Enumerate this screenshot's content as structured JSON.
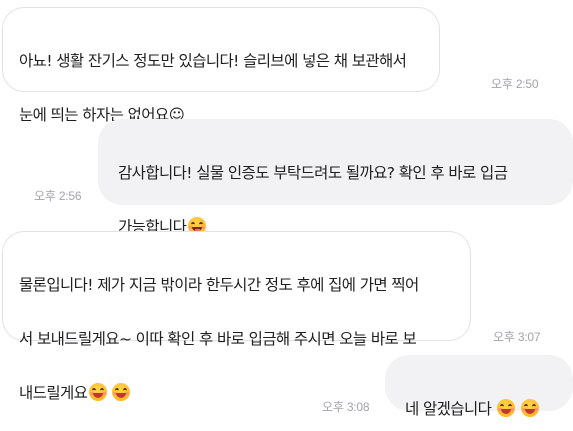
{
  "messages": [
    {
      "direction": "received",
      "lines": [
        "아뇨! 생활 잔기스 정도만 있습니다! 슬리브에 넣은 채 보관해서",
        "눈에 띄는 하자는 없어요☺"
      ],
      "time": "오후 2:50"
    },
    {
      "direction": "sent",
      "lines": [
        "감사합니다! 실물 인증도 부탁드려도 될까요? 확인 후 바로 입금",
        "가능합니다"
      ],
      "emoji": [
        "face-savoring-food"
      ],
      "time": "오후 2:56"
    },
    {
      "direction": "received",
      "lines": [
        "물론입니다! 제가 지금 밖이라 한두시간 정도 후에 집에 가면 찍어",
        "서 보내드릴게요~ 이따 확인 후 바로 입금해 주시면 오늘 바로 보",
        "내드릴게요"
      ],
      "emoji": [
        "smiling-face-with-smiling-eyes",
        "smiling-face-with-smiling-eyes"
      ],
      "time": "오후 3:07"
    },
    {
      "direction": "sent",
      "lines": [
        "네 알겠습니다"
      ],
      "emoji": [
        "smiling-face-with-smiling-eyes",
        "smiling-face-with-smiling-eyes"
      ],
      "time": "오후 3:08"
    }
  ],
  "colors": {
    "sent_bubble": "#f2f2f4",
    "received_border": "#e2e2e6",
    "time_text": "#a3a3a8",
    "message_text": "#1f1f1f"
  }
}
